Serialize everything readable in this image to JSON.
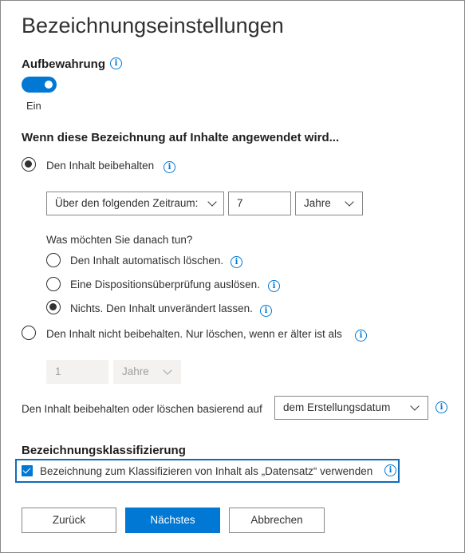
{
  "page": {
    "title": "Bezeichnungseinstellungen"
  },
  "retention": {
    "label": "Aufbewahrung",
    "toggle_state": "Ein",
    "toggle_on": true
  },
  "applied": {
    "heading": "Wenn diese Bezeichnung auf Inhalte angewendet wird...",
    "keep": {
      "label": "Den Inhalt beibehalten",
      "checked": true,
      "period_select": "Über den folgenden Zeitraum:",
      "period_value": "7",
      "unit_select": "Jahre",
      "after_question": "Was möchten Sie danach tun?",
      "after_options": [
        {
          "label": "Den Inhalt automatisch löschen.",
          "checked": false
        },
        {
          "label": "Eine Dispositionsüberprüfung auslösen.",
          "checked": false
        },
        {
          "label": "Nichts. Den Inhalt unverändert lassen.",
          "checked": true
        }
      ]
    },
    "dont_keep": {
      "label": "Den Inhalt nicht beibehalten. Nur löschen, wenn er älter ist als",
      "checked": false,
      "value_placeholder": "1",
      "unit_select": "Jahre"
    },
    "based_on": {
      "label": "Den Inhalt beibehalten oder löschen basierend auf",
      "select_value": "dem Erstellungsdatum"
    }
  },
  "classification": {
    "heading": "Bezeichnungsklassifizierung",
    "checkbox_label": "Bezeichnung zum Klassifizieren von Inhalt als „Datensatz“ verwenden",
    "checked": true
  },
  "buttons": {
    "back": "Zurück",
    "next": "Nächstes",
    "cancel": "Abbrechen"
  },
  "icons": {
    "info": "info-icon",
    "chevron": "chevron-down-icon",
    "check": "checkmark-icon"
  },
  "colors": {
    "accent": "#0078d4",
    "text": "#323130",
    "disabled_bg": "#f3f2f1"
  }
}
